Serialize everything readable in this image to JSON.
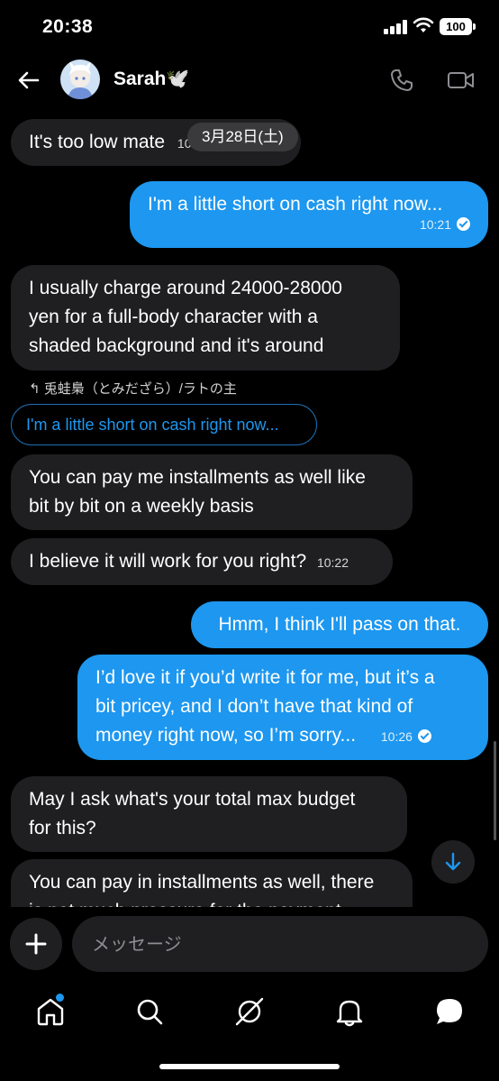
{
  "status_bar": {
    "time": "20:38",
    "battery": "100"
  },
  "header": {
    "contact_name": "Sarah🕊️"
  },
  "date_divider": "3月28日(土)",
  "messages": [
    {
      "text": "It's too low mate",
      "time": "10:20"
    },
    {
      "text": "I'm a little short on cash right now...",
      "time": "10:21"
    },
    {
      "lines": [
        "I usually charge around 24000-28000",
        "yen for a full-body character with a",
        "shaded background and it's around"
      ]
    },
    {
      "lines": [
        "You can pay me installments as well like",
        "bit by bit on a weekly basis"
      ]
    },
    {
      "text": "I believe it will work for you right?",
      "time": "10:22"
    },
    {
      "text": "Hmm, I think I'll pass on that."
    },
    {
      "lines": [
        "I’d love it if you’d write it for me, but it’s a",
        "bit pricey, and I don’t have that kind of",
        "money right now, so I’m sorry..."
      ],
      "time": "10:26"
    },
    {
      "lines": [
        "May I ask what's your total max budget",
        "for this?"
      ]
    },
    {
      "lines": [
        "You can pay in installments as well, there",
        "is not much pressure for the payment"
      ]
    }
  ],
  "reply": {
    "author": "兎蛙梟（とみだざら）/ラトの主",
    "quoted_text": "I'm a little short on cash right now..."
  },
  "composer": {
    "placeholder": "メッセージ"
  },
  "colors": {
    "accent": "#1d97ef",
    "bubble_in": "#1f1f21",
    "background": "#000000"
  },
  "nav": {
    "items": [
      "home-icon",
      "search-icon",
      "explore-icon",
      "bell-icon",
      "chat-icon"
    ]
  }
}
